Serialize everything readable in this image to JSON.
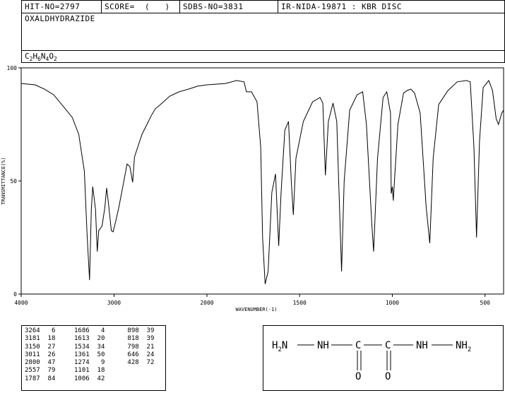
{
  "header": {
    "hit_no": "HIT-NO=2797",
    "score": "SCORE=  (   )",
    "sdbs_no": "SDBS-NO=3831",
    "ir_info": "IR-NIDA-19871 : KBR DISC",
    "compound_name": "OXALDHYDRAZIDE",
    "formula_parts": [
      {
        "t": "C",
        "sub": false
      },
      {
        "t": "2",
        "sub": true
      },
      {
        "t": "H",
        "sub": false
      },
      {
        "t": "6",
        "sub": true
      },
      {
        "t": "N",
        "sub": false
      },
      {
        "t": "4",
        "sub": true
      },
      {
        "t": "O",
        "sub": false
      },
      {
        "t": "2",
        "sub": true
      }
    ]
  },
  "chart_data": {
    "type": "line",
    "xlabel": "WAVENUMBER(-1)",
    "ylabel": "TRANSMITTANCE(%)",
    "xlim": [
      4000,
      400
    ],
    "ylim": [
      0,
      100
    ],
    "x_ticks": [
      4000,
      3000,
      2000,
      1500,
      1000,
      500
    ],
    "y_ticks": [
      0,
      50,
      100
    ],
    "series": [
      {
        "points": [
          [
            4000,
            93.1
          ],
          [
            3850,
            92.5
          ],
          [
            3750,
            90.6
          ],
          [
            3650,
            88.1
          ],
          [
            3550,
            83.1
          ],
          [
            3450,
            78.1
          ],
          [
            3380,
            70.6
          ],
          [
            3320,
            54.4
          ],
          [
            3290,
            25.6
          ],
          [
            3264,
            6.2
          ],
          [
            3245,
            37.5
          ],
          [
            3230,
            47.5
          ],
          [
            3200,
            37.5
          ],
          [
            3181,
            18.8
          ],
          [
            3165,
            28.1
          ],
          [
            3130,
            30.0
          ],
          [
            3100,
            38.1
          ],
          [
            3080,
            46.9
          ],
          [
            3060,
            40.0
          ],
          [
            3030,
            28.1
          ],
          [
            3011,
            27.5
          ],
          [
            2980,
            32.5
          ],
          [
            2950,
            38.1
          ],
          [
            2900,
            48.8
          ],
          [
            2860,
            57.5
          ],
          [
            2830,
            56.3
          ],
          [
            2800,
            49.4
          ],
          [
            2780,
            60.6
          ],
          [
            2700,
            70.6
          ],
          [
            2600,
            78.8
          ],
          [
            2557,
            81.9
          ],
          [
            2500,
            83.8
          ],
          [
            2400,
            87.5
          ],
          [
            2300,
            89.4
          ],
          [
            2200,
            90.6
          ],
          [
            2100,
            91.9
          ],
          [
            2000,
            92.5
          ],
          [
            1900,
            93.1
          ],
          [
            1840,
            94.4
          ],
          [
            1800,
            93.8
          ],
          [
            1787,
            89.4
          ],
          [
            1760,
            89.4
          ],
          [
            1730,
            85.0
          ],
          [
            1710,
            65.0
          ],
          [
            1700,
            25.0
          ],
          [
            1686,
            4.4
          ],
          [
            1670,
            10.0
          ],
          [
            1650,
            45.0
          ],
          [
            1630,
            53.1
          ],
          [
            1613,
            21.3
          ],
          [
            1600,
            45.0
          ],
          [
            1580,
            72.5
          ],
          [
            1560,
            76.3
          ],
          [
            1545,
            50.0
          ],
          [
            1534,
            35.0
          ],
          [
            1520,
            60.0
          ],
          [
            1480,
            76.3
          ],
          [
            1430,
            85.0
          ],
          [
            1390,
            86.9
          ],
          [
            1375,
            84.4
          ],
          [
            1361,
            52.5
          ],
          [
            1345,
            76.3
          ],
          [
            1320,
            84.4
          ],
          [
            1300,
            76.3
          ],
          [
            1274,
            10.0
          ],
          [
            1260,
            50.0
          ],
          [
            1230,
            81.3
          ],
          [
            1190,
            88.1
          ],
          [
            1160,
            89.4
          ],
          [
            1140,
            75.0
          ],
          [
            1110,
            30.0
          ],
          [
            1101,
            18.8
          ],
          [
            1080,
            60.0
          ],
          [
            1050,
            86.9
          ],
          [
            1030,
            89.4
          ],
          [
            1010,
            80.0
          ],
          [
            1006,
            44.4
          ],
          [
            1000,
            47.5
          ],
          [
            995,
            41.3
          ],
          [
            970,
            75.0
          ],
          [
            940,
            88.8
          ],
          [
            920,
            90.0
          ],
          [
            900,
            90.6
          ],
          [
            880,
            88.8
          ],
          [
            850,
            80.0
          ],
          [
            818,
            38.8
          ],
          [
            798,
            22.5
          ],
          [
            780,
            60.0
          ],
          [
            750,
            83.8
          ],
          [
            700,
            90.0
          ],
          [
            650,
            93.8
          ],
          [
            600,
            94.4
          ],
          [
            580,
            93.8
          ],
          [
            560,
            65.0
          ],
          [
            546,
            25.0
          ],
          [
            530,
            67.5
          ],
          [
            510,
            91.3
          ],
          [
            480,
            94.4
          ],
          [
            460,
            90.0
          ],
          [
            440,
            77.5
          ],
          [
            428,
            75.0
          ],
          [
            410,
            80.0
          ],
          [
            400,
            81.3
          ]
        ]
      }
    ]
  },
  "peak_table": [
    {
      "wn": "3264",
      "t": "6"
    },
    {
      "wn": "3181",
      "t": "18"
    },
    {
      "wn": "3150",
      "t": "27"
    },
    {
      "wn": "3011",
      "t": "26"
    },
    {
      "wn": "2800",
      "t": "47"
    },
    {
      "wn": "2557",
      "t": "79"
    },
    {
      "wn": "1787",
      "t": "84"
    },
    {
      "wn": "1686",
      "t": "4"
    },
    {
      "wn": "1613",
      "t": "20"
    },
    {
      "wn": "1534",
      "t": "34"
    },
    {
      "wn": "1361",
      "t": "50"
    },
    {
      "wn": "1274",
      "t": "9"
    },
    {
      "wn": "1101",
      "t": "18"
    },
    {
      "wn": "1006",
      "t": "42"
    },
    {
      "wn": "898",
      "t": "39"
    },
    {
      "wn": "818",
      "t": "39"
    },
    {
      "wn": "798",
      "t": "21"
    },
    {
      "wn": "646",
      "t": "24"
    },
    {
      "wn": "428",
      "t": "72"
    }
  ],
  "structure": {
    "h2n": "H",
    "h2n_sub": "2",
    "h2n_n": "N",
    "nh1": "NH",
    "c1": "C",
    "c2": "C",
    "nh2": "NH",
    "nh2_n": "NH",
    "nh2_sub": "2",
    "o1": "O",
    "o2": "O"
  }
}
